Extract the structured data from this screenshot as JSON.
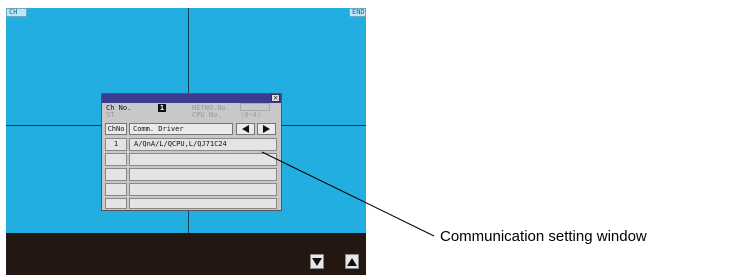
{
  "screen": {
    "top_left_button": "CH",
    "top_right_button": "END"
  },
  "dialog": {
    "close_symbol": "×",
    "ch_no_label": "Ch No.",
    "ch_no_value": "1",
    "station_label": "ST",
    "station_value": "",
    "net_no_label": "NETNO.No.",
    "net_no_value": "",
    "cpu_no_label": "CPU No.",
    "cpu_no_value": "(0~4)",
    "table": {
      "header_no": "ChNo",
      "header_driver": "Comm. Driver",
      "rows": [
        {
          "no": "1",
          "driver": "A/QnA/L/QCPU,L/QJ71C24"
        },
        {
          "no": "",
          "driver": ""
        },
        {
          "no": "",
          "driver": ""
        },
        {
          "no": "",
          "driver": ""
        },
        {
          "no": "",
          "driver": ""
        }
      ]
    }
  },
  "callout": {
    "label": "Communication setting window"
  }
}
